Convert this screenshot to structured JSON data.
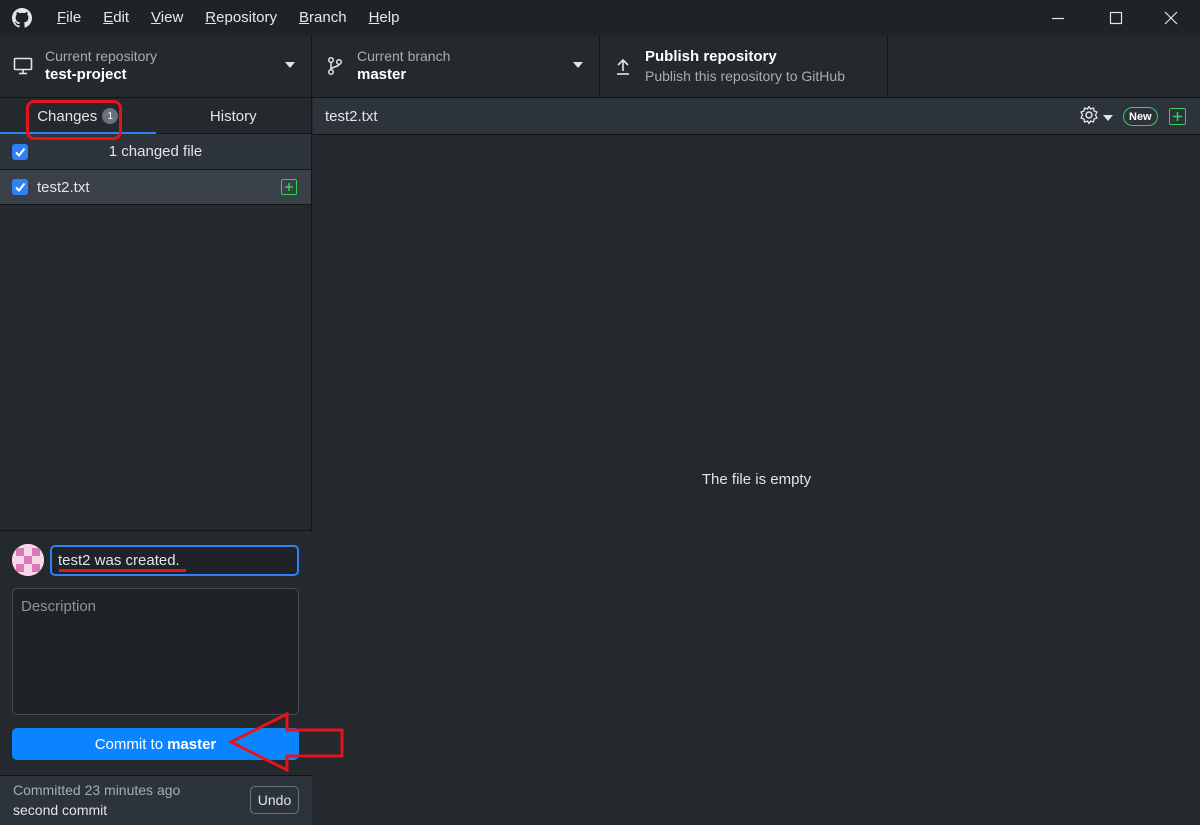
{
  "menu": {
    "items": [
      {
        "accel": "F",
        "rest": "ile"
      },
      {
        "accel": "E",
        "rest": "dit"
      },
      {
        "accel": "V",
        "rest": "iew"
      },
      {
        "accel": "R",
        "rest": "epository"
      },
      {
        "accel": "B",
        "rest": "ranch"
      },
      {
        "accel": "H",
        "rest": "elp"
      }
    ]
  },
  "toolbar": {
    "repo_label": "Current repository",
    "repo_name": "test-project",
    "branch_label": "Current branch",
    "branch_name": "master",
    "publish_title": "Publish repository",
    "publish_desc": "Publish this repository to GitHub"
  },
  "tabs": {
    "changes_label": "Changes",
    "changes_count": "1",
    "history_label": "History"
  },
  "changes": {
    "header": "1 changed file",
    "files": [
      {
        "name": "test2.txt"
      }
    ]
  },
  "commit": {
    "summary_value": "test2 was created.",
    "description_placeholder": "Description",
    "button_prefix": "Commit to",
    "button_branch": "master"
  },
  "last_commit": {
    "when": "Committed 23 minutes ago",
    "message": "second commit",
    "undo_label": "Undo"
  },
  "diff": {
    "file_name": "test2.txt",
    "new_badge": "New",
    "empty_message": "The file is empty"
  },
  "colors": {
    "accent": "#2f81f7",
    "commit_button": "#0a84ff",
    "added_green": "#34d058",
    "annotation_red": "#e4141b"
  }
}
